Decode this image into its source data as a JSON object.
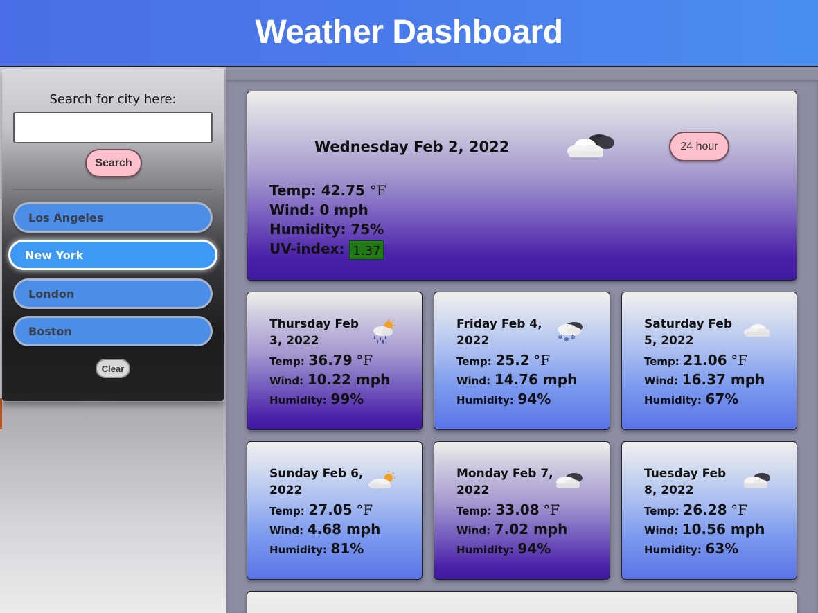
{
  "header": {
    "title": "Weather Dashboard"
  },
  "sidebar": {
    "search_label": "Search for city here:",
    "search_value": "",
    "search_button": "Search",
    "cities": [
      {
        "label": "Los Angeles",
        "active": false
      },
      {
        "label": "New York",
        "active": true
      },
      {
        "label": "London",
        "active": false
      },
      {
        "label": "Boston",
        "active": false
      }
    ],
    "clear_button": "Clear"
  },
  "today": {
    "date": "Wednesday Feb 2, 2022",
    "icon": "cloudy-night-icon",
    "hour_button": "24 hour",
    "temp_label": "Temp:",
    "temp_value": "42.75",
    "temp_unit": "°F",
    "wind_label": "Wind:",
    "wind_value": "0 mph",
    "humidity_label": "Humidity:",
    "humidity_value": "75%",
    "uv_label": "UV-index:",
    "uv_value": "1.37",
    "uv_color": "#1f7a16"
  },
  "forecast": [
    {
      "date": "Thursday Feb 3, 2022",
      "icon": "rain-sun-icon",
      "temp": "36.79",
      "unit": "°F",
      "wind": "10.22 mph",
      "humidity": "99%",
      "temp_label": "Temp:",
      "wind_label": "Wind:",
      "humidity_label": "Humidity:"
    },
    {
      "date": "Friday Feb 4, 2022",
      "icon": "snow-cloud-icon",
      "temp": "25.2",
      "unit": "°F",
      "wind": "14.76 mph",
      "humidity": "94%",
      "temp_label": "Temp:",
      "wind_label": "Wind:",
      "humidity_label": "Humidity:"
    },
    {
      "date": "Saturday Feb 5, 2022",
      "icon": "cloud-icon",
      "temp": "21.06",
      "unit": "°F",
      "wind": "16.37 mph",
      "humidity": "67%",
      "temp_label": "Temp:",
      "wind_label": "Wind:",
      "humidity_label": "Humidity:"
    },
    {
      "date": "Sunday Feb 6, 2022",
      "icon": "partly-sunny-icon",
      "temp": "27.05",
      "unit": "°F",
      "wind": "4.68 mph",
      "humidity": "81%",
      "temp_label": "Temp:",
      "wind_label": "Wind:",
      "humidity_label": "Humidity:"
    },
    {
      "date": "Monday Feb 7, 2022",
      "icon": "cloudy-icon",
      "temp": "33.08",
      "unit": "°F",
      "wind": "7.02 mph",
      "humidity": "94%",
      "temp_label": "Temp:",
      "wind_label": "Wind:",
      "humidity_label": "Humidity:"
    },
    {
      "date": "Tuesday Feb 8, 2022",
      "icon": "cloudy-icon",
      "temp": "26.28",
      "unit": "°F",
      "wind": "10.56 mph",
      "humidity": "63%",
      "temp_label": "Temp:",
      "wind_label": "Wind:",
      "humidity_label": "Humidity:"
    }
  ],
  "colors": {
    "header": "#4a7bea",
    "accent_pink": "#ffc0cb",
    "city_button": "#4a8ee8",
    "city_active": "#3e99f5"
  }
}
